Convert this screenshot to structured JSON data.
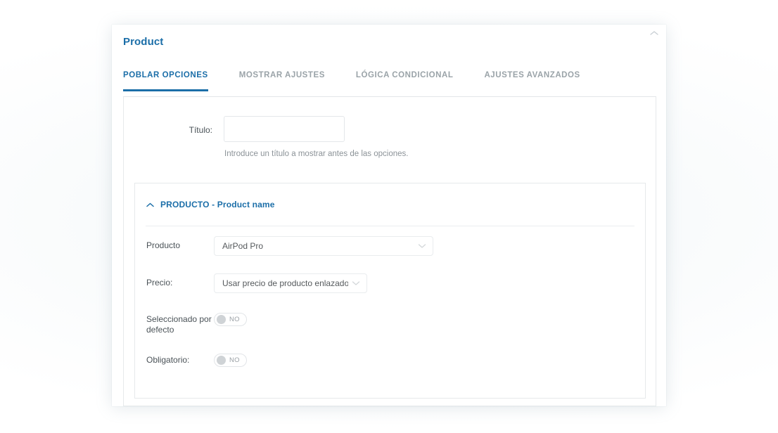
{
  "panel": {
    "title": "Product",
    "collapse_icon": "chevron-up-icon"
  },
  "tabs": [
    {
      "label": "POBLAR OPCIONES",
      "active": true
    },
    {
      "label": "MOSTRAR AJUSTES",
      "active": false
    },
    {
      "label": "LÓGICA CONDICIONAL",
      "active": false
    },
    {
      "label": "AJUSTES AVANZADOS",
      "active": false
    }
  ],
  "form": {
    "titulo": {
      "label": "Título:",
      "value": "",
      "placeholder": "",
      "helper": "Introduce un título a mostrar antes de las opciones."
    }
  },
  "accordion": {
    "caret_icon": "chevron-up-icon",
    "title": "PRODUCTO - Product name",
    "fields": {
      "producto": {
        "label": "Producto",
        "value": "AirPod Pro",
        "caret_icon": "chevron-down-icon"
      },
      "precio": {
        "label": "Precio:",
        "value": "Usar precio de producto enlazado",
        "caret_icon": "chevron-down-icon"
      },
      "seleccionado": {
        "label": "Seleccionado por defecto",
        "state": "NO"
      },
      "obligatorio": {
        "label": "Obligatorio:",
        "state": "NO"
      }
    }
  },
  "colors": {
    "accent": "#1b6ea8",
    "muted_text": "#9aa3a8",
    "border": "#e6e9eb"
  }
}
